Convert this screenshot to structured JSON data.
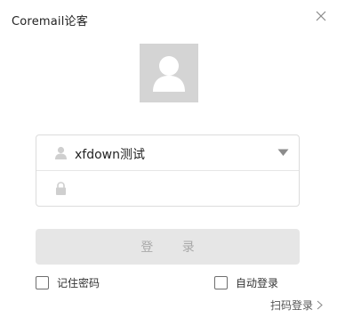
{
  "window": {
    "title": "Coremail论客"
  },
  "login": {
    "account_value": "xfdown测试",
    "password_value": "",
    "password_placeholder": "",
    "login_button_label": "登 录",
    "remember_password_label": "记住密码",
    "auto_login_label": "自动登录",
    "qr_login_label": "扫码登录"
  },
  "icons": {
    "close": "close-icon",
    "avatar": "user-avatar-icon",
    "account": "user-icon",
    "password": "lock-icon",
    "dropdown": "caret-down-icon",
    "qr_chevron": "chevron-right-icon"
  },
  "colors": {
    "avatar_bg": "#d4d4d4",
    "avatar_fg": "#ffffff",
    "login_button_bg": "#e6e6e6",
    "login_button_text": "#a9a9a9",
    "border": "#dcdcdc"
  }
}
